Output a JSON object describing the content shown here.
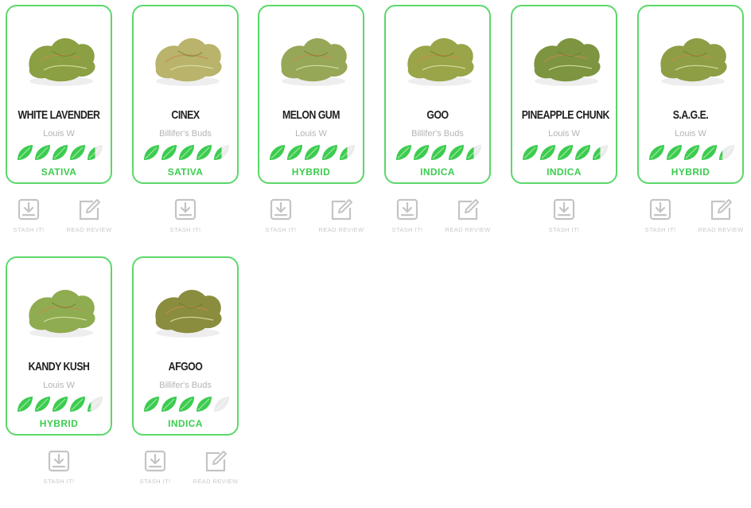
{
  "colors": {
    "accent": "#3ccc4f",
    "border": "#5bd86a",
    "leaf_empty": "#ebebeb",
    "muted": "#b4b4b4"
  },
  "strains": [
    {
      "name": "WHITE LAVENDER",
      "grower": "Louis W",
      "type": "SATIVA",
      "rating": 4.5,
      "stash_label": "STASH IT!",
      "review_label": "READ REVIEW",
      "bud_color": "#8aa043"
    },
    {
      "name": "CINEX",
      "grower": "Billifer's Buds",
      "type": "SATIVA",
      "rating": 4.5,
      "stash_label": "STASH IT!",
      "review_label": null,
      "bud_color": "#b9b36b"
    },
    {
      "name": "MELON GUM",
      "grower": "Louis W",
      "type": "HYBRID",
      "rating": 4.5,
      "stash_label": "STASH IT!",
      "review_label": "READ REVIEW",
      "bud_color": "#96a757"
    },
    {
      "name": "GOO",
      "grower": "Billifer's Buds",
      "type": "INDICA",
      "rating": 4.5,
      "stash_label": "STASH IT!",
      "review_label": "READ REVIEW",
      "bud_color": "#9aa448"
    },
    {
      "name": "PINEAPPLE CHUNK",
      "grower": "Louis W",
      "type": "INDICA",
      "rating": 4.5,
      "stash_label": "STASH IT!",
      "review_label": null,
      "bud_color": "#7d9440"
    },
    {
      "name": "S.A.G.E.",
      "grower": "Louis W",
      "type": "HYBRID",
      "rating": 4.25,
      "stash_label": "STASH IT!",
      "review_label": "READ REVIEW",
      "bud_color": "#8d9e45"
    },
    {
      "name": "KANDY KUSH",
      "grower": "Louis W",
      "type": "HYBRID",
      "rating": 4.25,
      "stash_label": "STASH IT!",
      "review_label": null,
      "bud_color": "#8fac50"
    },
    {
      "name": "AFGOO",
      "grower": "Billifer's Buds",
      "type": "INDICA",
      "rating": 4,
      "stash_label": "STASH IT!",
      "review_label": "READ REVIEW",
      "bud_color": "#8a8d3e"
    }
  ]
}
